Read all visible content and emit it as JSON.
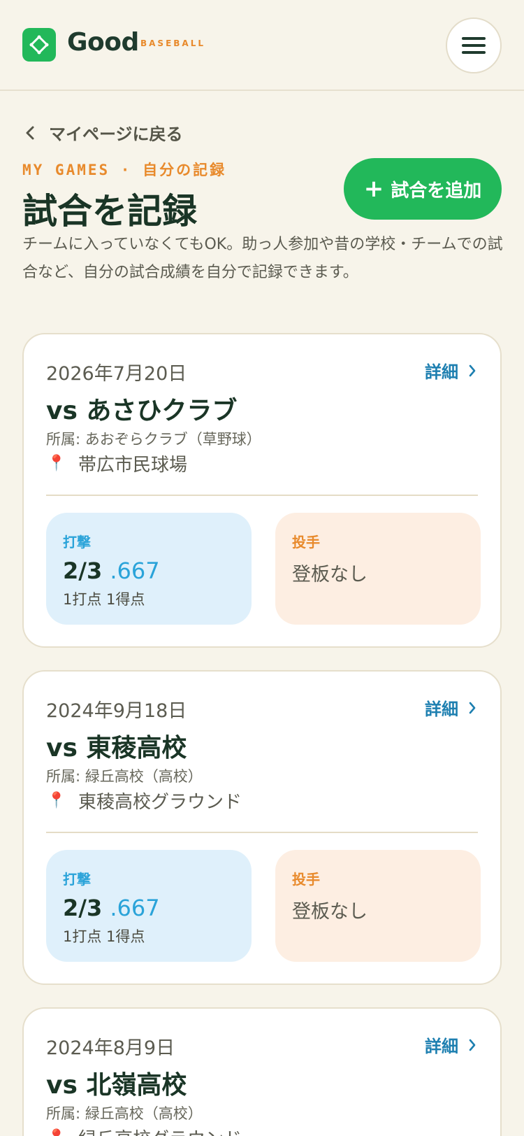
{
  "header": {
    "logo_text": "Good",
    "logo_sub": "BASEBALL",
    "menu_icon": "hamburger-icon",
    "brand_color": "#22b85a",
    "accent_color": "#e88a2c"
  },
  "page": {
    "back_label": "マイページに戻る",
    "eyebrow": "MY GAMES · 自分の記録",
    "title": "試合を記録",
    "add_button": "試合を追加",
    "description": "チームに入っていなくてもOK。助っ人参加や昔の学校・チームでの試合など、自分の試合成績を自分で記録できます。"
  },
  "games": [
    {
      "date": "2026年7月20日",
      "detail_label": "詳細",
      "opponent": "vs あさひクラブ",
      "team": "所属: あおぞらクラブ（草野球）",
      "venue": "帯広市民球場",
      "batting": {
        "label": "打撃",
        "hits": "2/3",
        "avg": ".667",
        "rbi_runs": "1打点 1得点"
      },
      "pitching": {
        "label": "投手",
        "value": "登板なし"
      }
    },
    {
      "date": "2024年9月18日",
      "detail_label": "詳細",
      "opponent": "vs 東稜高校",
      "team": "所属: 緑丘高校（高校）",
      "venue": "東稜高校グラウンド",
      "batting": {
        "label": "打撃",
        "hits": "2/3",
        "avg": ".667",
        "rbi_runs": "1打点 1得点"
      },
      "pitching": {
        "label": "投手",
        "value": "登板なし"
      }
    },
    {
      "date": "2024年8月9日",
      "detail_label": "詳細",
      "opponent": "vs 北嶺高校",
      "team": "所属: 緑丘高校（高校）",
      "venue": "緑丘高校グラウンド"
    }
  ]
}
